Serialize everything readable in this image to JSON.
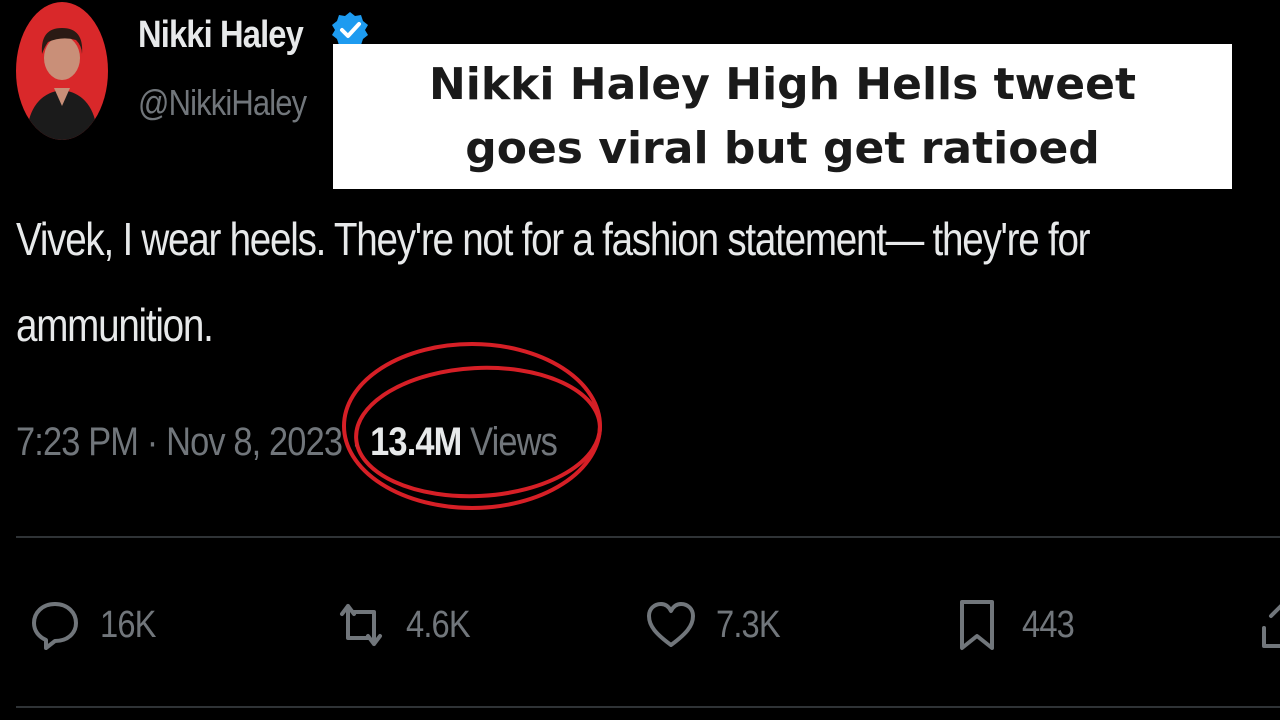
{
  "profile": {
    "display_name": "Nikki Haley",
    "handle": "@NikkiHaley",
    "verified": true,
    "avatar_bg": "#d9282a"
  },
  "banner": {
    "line1": "Nikki Haley High Hells tweet",
    "line2": "goes viral but get ratioed"
  },
  "tweet": {
    "line1": "Vivek, I wear heels. They're not for a fashion statement— they're for",
    "line2": "ammunition.",
    "time": "7:23 PM · Nov 8, 2023",
    "separator": "·",
    "views_count": "13.4M",
    "views_label": "Views"
  },
  "actions": {
    "replies": "16K",
    "reposts": "4.6K",
    "likes": "7.3K",
    "bookmarks": "443"
  },
  "colors": {
    "text": "#e7e9ea",
    "muted": "#71767b",
    "verified": "#1d9bf0",
    "annotation": "#d61f26"
  }
}
